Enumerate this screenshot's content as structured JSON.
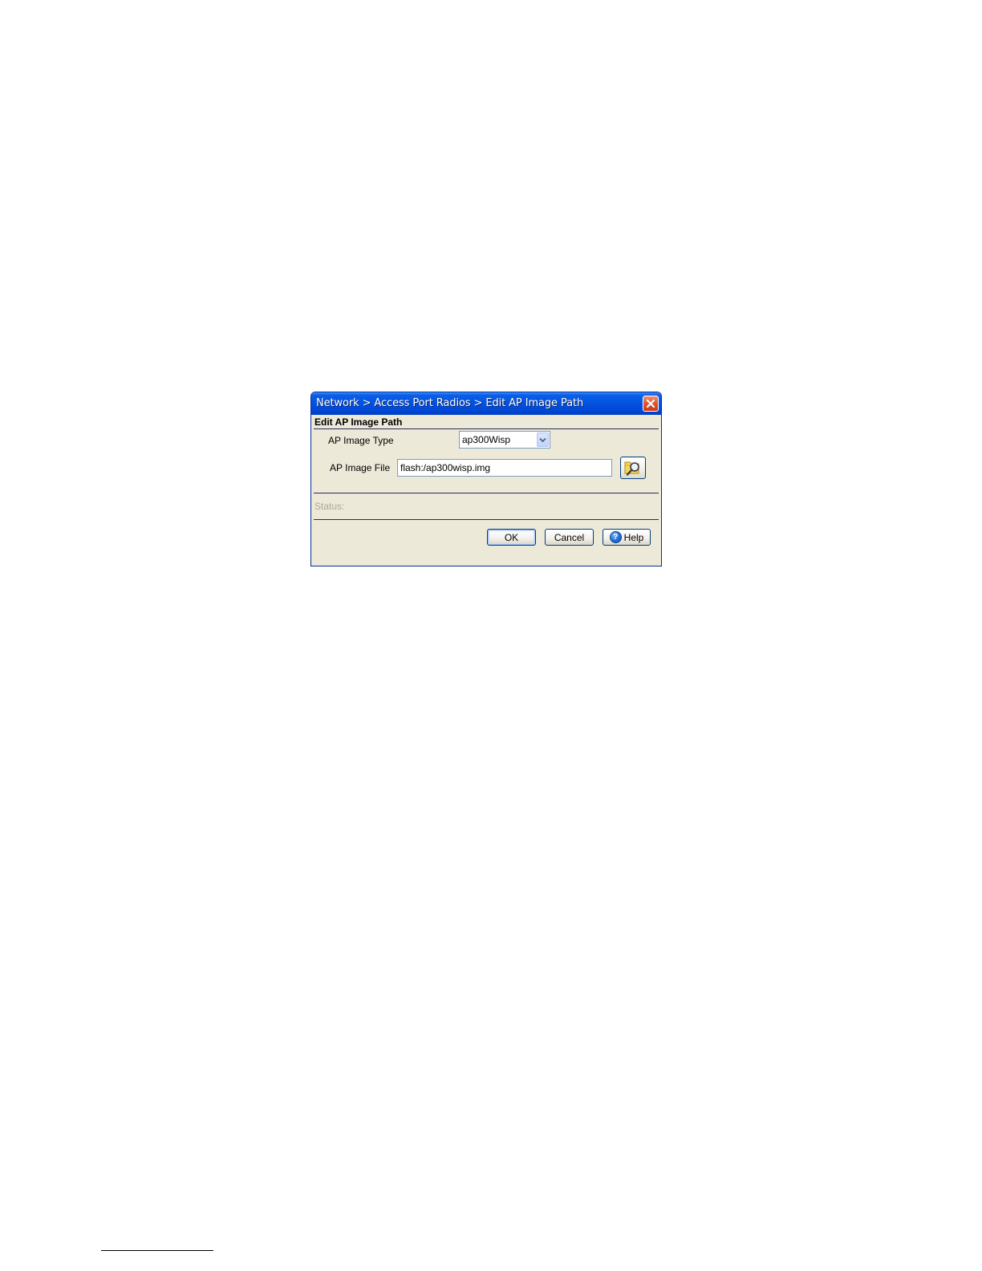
{
  "dialog": {
    "title": "Network > Access Port Radios > Edit AP Image Path",
    "section_title": "Edit AP Image Path",
    "image_type": {
      "label": "AP Image Type",
      "selected": "ap300Wisp"
    },
    "image_file": {
      "label": "AP Image File",
      "value": "flash:/ap300wisp.img"
    },
    "status_label": "Status:",
    "buttons": {
      "ok": "OK",
      "cancel": "Cancel",
      "help": "Help"
    }
  },
  "icons": {
    "close": "close-icon",
    "dropdown": "chevron-down-icon",
    "browse": "folder-search-icon",
    "help": "help-icon"
  },
  "colors": {
    "titlebar": "#0553e0",
    "dialog_background": "#ece9d8",
    "close_button": "#e0532e",
    "status_text": "#aca899"
  }
}
